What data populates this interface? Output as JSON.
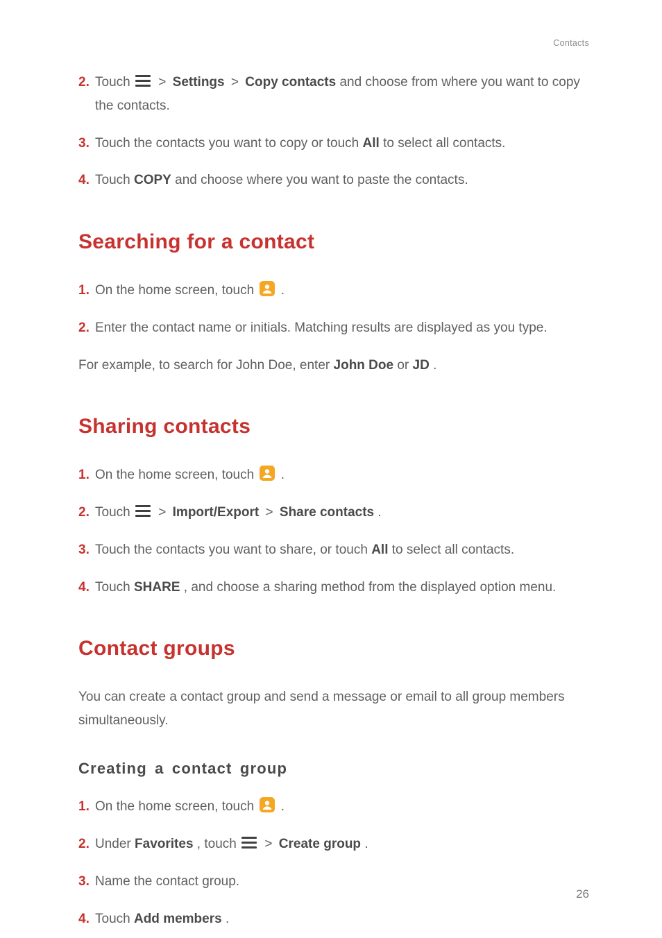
{
  "header": {
    "label": "Contacts"
  },
  "page_number": "26",
  "intro_steps": {
    "s2": {
      "prefix": "Touch ",
      "settings": "Settings",
      "copy_contacts": "Copy contacts",
      "suffix": " and choose from where you want to copy the contacts."
    },
    "s3": {
      "prefix": "Touch the contacts you want to copy or touch ",
      "all": "All",
      "suffix": " to select all contacts."
    },
    "s4": {
      "prefix": "Touch ",
      "copy": "COPY",
      "suffix": " and choose where you want to paste the contacts."
    }
  },
  "search": {
    "heading": "Searching for a contact",
    "s1": {
      "prefix": "On the home screen, touch ",
      "suffix": "."
    },
    "s2": {
      "text": "Enter the contact name or initials. Matching results are displayed as you type."
    },
    "note": {
      "prefix": "For example, to search for John Doe, enter ",
      "jd1": "John Doe",
      "or": " or ",
      "jd2": "JD",
      "suffix": "."
    }
  },
  "sharing": {
    "heading": "Sharing contacts",
    "s1": {
      "prefix": "On the home screen, touch ",
      "suffix": "."
    },
    "s2": {
      "prefix": "Touch ",
      "ie": "Import/Export",
      "sc": "Share contacts",
      "suffix": "."
    },
    "s3": {
      "prefix": "Touch the contacts you want to share, or touch ",
      "all": "All",
      "suffix": " to select all contacts."
    },
    "s4": {
      "prefix": "Touch ",
      "share": "SHARE",
      "suffix": ", and choose a sharing method from the displayed option menu."
    }
  },
  "groups": {
    "heading": "Contact groups",
    "intro": "You can create a contact group and send a message or email to all group members simultaneously.",
    "sub": "Creating a contact group",
    "s1": {
      "prefix": "On the home screen, touch ",
      "suffix": "."
    },
    "s2": {
      "prefix": "Under ",
      "fav": "Favorites",
      "mid": ", touch ",
      "cg": "Create group",
      "suffix": "."
    },
    "s3": {
      "text": "Name the contact group."
    },
    "s4": {
      "prefix": "Touch ",
      "am": "Add members",
      "suffix": "."
    }
  },
  "nums": {
    "n1": "1.",
    "n2": "2.",
    "n3": "3.",
    "n4": "4."
  },
  "symbols": {
    "gt": ">"
  }
}
